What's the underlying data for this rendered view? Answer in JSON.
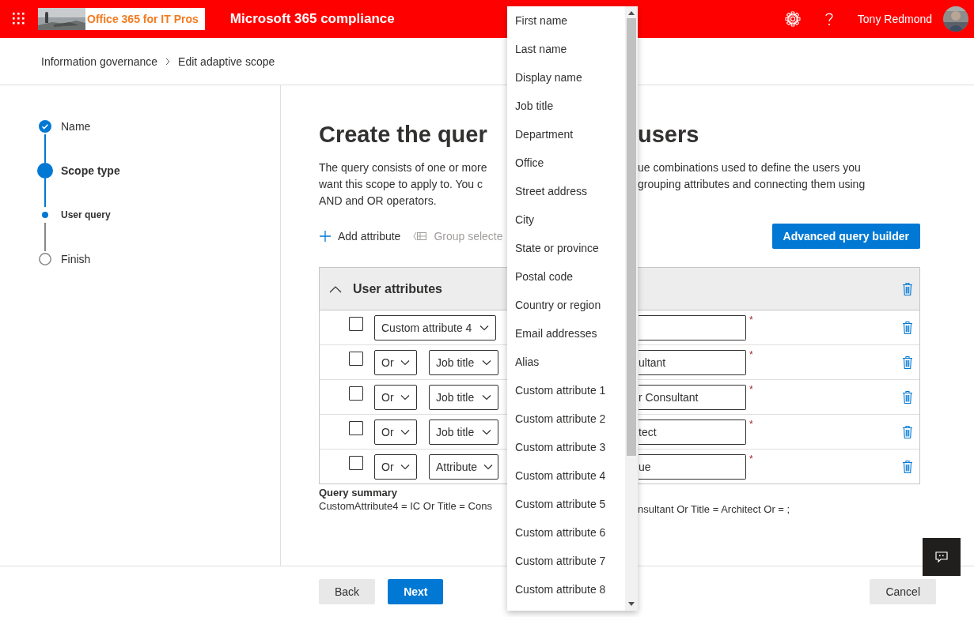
{
  "app": {
    "brand": "Office 365 for IT Pros",
    "title": "Microsoft 365 compliance",
    "user": "Tony Redmond"
  },
  "breadcrumb": [
    "Information governance",
    "Edit adaptive scope"
  ],
  "steps": [
    {
      "label": "Name",
      "kind": "step",
      "done": true,
      "current": false
    },
    {
      "label": "Scope type",
      "kind": "step",
      "done": false,
      "current": true
    },
    {
      "label": "User query",
      "kind": "substep",
      "done": false,
      "current": true
    },
    {
      "label": "Finish",
      "kind": "step",
      "done": false,
      "current": false
    }
  ],
  "heading": {
    "left": "Create the quer",
    "right": "users"
  },
  "description": {
    "left": [
      "The query consists of one or more",
      "want this scope to apply to. You c",
      "AND and OR operators."
    ],
    "right": [
      "ue combinations used to define the users you",
      "grouping attributes and connecting them using"
    ]
  },
  "toolbar": {
    "add": "Add attribute",
    "group": "Group selecte",
    "group_disabled": true,
    "advanced": "Advanced query builder"
  },
  "group": {
    "title": "User attributes",
    "expanded": true
  },
  "rows": [
    {
      "checked": false,
      "attribute": "Custom attribute 4",
      "required_mark": "*"
    },
    {
      "checked": false,
      "operator": "Or",
      "attribute": "Job title",
      "value": "ultant",
      "required_mark": "*"
    },
    {
      "checked": false,
      "operator": "Or",
      "attribute": "Job title",
      "value": "r Consultant",
      "required_mark": "*"
    },
    {
      "checked": false,
      "operator": "Or",
      "attribute": "Job title",
      "value": "tect",
      "required_mark": "*"
    },
    {
      "checked": false,
      "operator": "Or",
      "attribute": "Attribute",
      "value": "ue",
      "required_mark": "*"
    }
  ],
  "summary": {
    "label": "Query summary",
    "left": "CustomAttribute4 = IC Or Title = Cons",
    "right": "nsultant Or Title = Architect Or = ;"
  },
  "menu": {
    "items": [
      {
        "label": "First name",
        "selected": false
      },
      {
        "label": "Last name",
        "selected": false
      },
      {
        "label": "Display name",
        "selected": false
      },
      {
        "label": "Job title",
        "selected": false
      },
      {
        "label": "Department",
        "selected": false
      },
      {
        "label": "Office",
        "selected": false
      },
      {
        "label": "Street address",
        "selected": false
      },
      {
        "label": "City",
        "selected": false
      },
      {
        "label": "State or province",
        "selected": false
      },
      {
        "label": "Postal code",
        "selected": false
      },
      {
        "label": "Country or region",
        "selected": false
      },
      {
        "label": "Email addresses",
        "selected": false
      },
      {
        "label": "Alias",
        "selected": false
      },
      {
        "label": "Custom attribute 1",
        "selected": false
      },
      {
        "label": "Custom attribute 2",
        "selected": false
      },
      {
        "label": "Custom attribute 3",
        "selected": false
      },
      {
        "label": "Custom attribute 4",
        "selected": false
      },
      {
        "label": "Custom attribute 5",
        "selected": false
      },
      {
        "label": "Custom attribute 6",
        "selected": false
      },
      {
        "label": "Custom attribute 7",
        "selected": false
      },
      {
        "label": "Custom attribute 8",
        "selected": false
      }
    ]
  },
  "footer": {
    "back": "Back",
    "next": "Next",
    "cancel": "Cancel"
  }
}
